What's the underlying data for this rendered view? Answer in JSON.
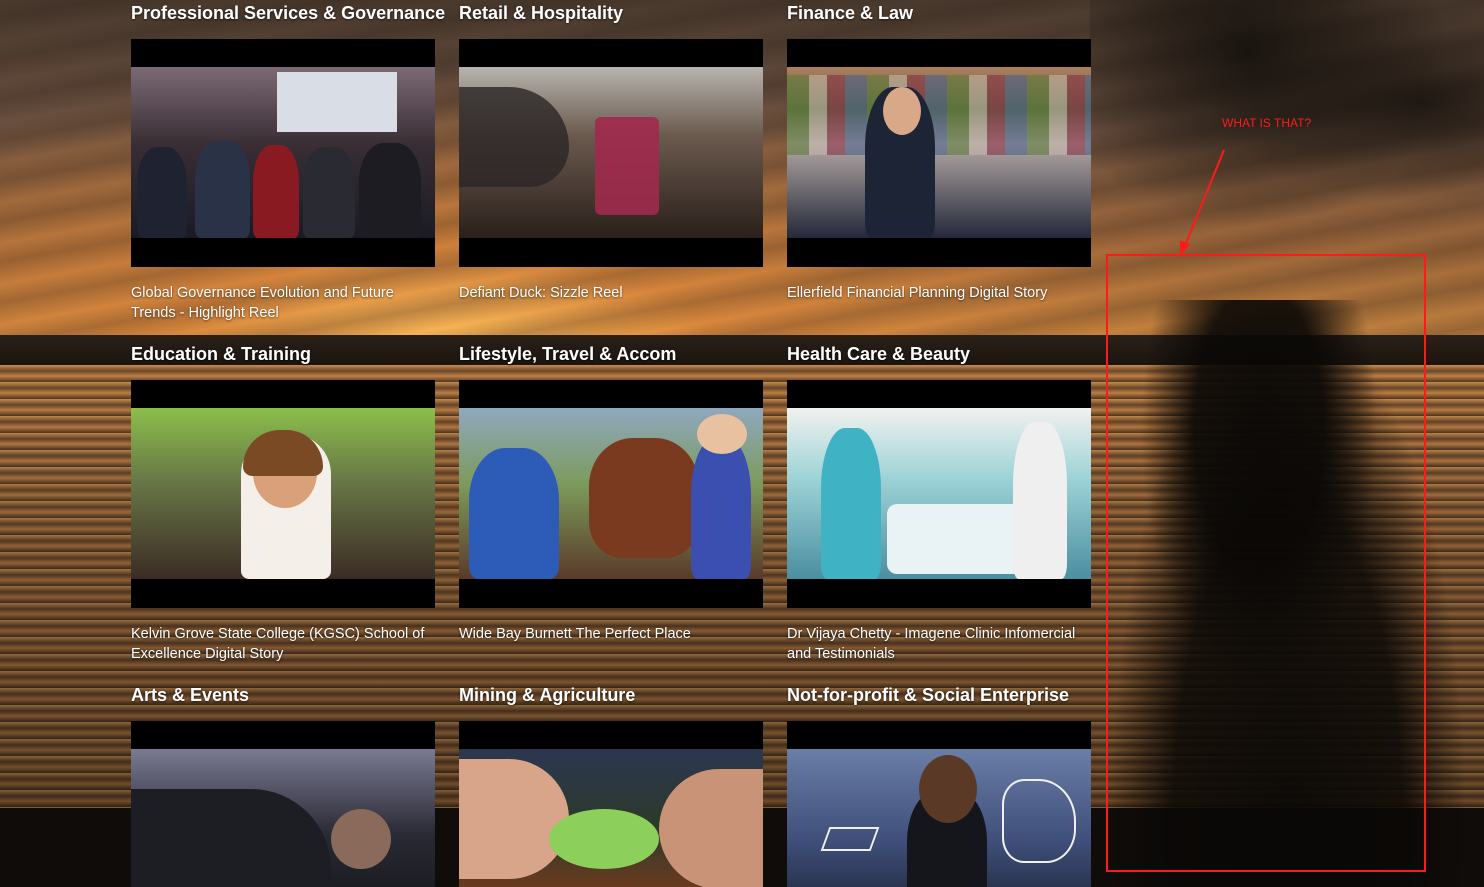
{
  "sections": [
    {
      "title": "Professional Services & Governance",
      "video": "Global Governance Evolution and Future Trends - Highlight Reel"
    },
    {
      "title": "Retail & Hospitality",
      "video": "Defiant Duck: Sizzle Reel"
    },
    {
      "title": "Finance & Law",
      "video": "Ellerfield Financial Planning Digital Story"
    },
    {
      "title": "Education & Training",
      "video": "Kelvin Grove State College (KGSC) School of Excellence Digital Story"
    },
    {
      "title": "Lifestyle, Travel & Accom",
      "video": "Wide Bay Burnett The Perfect Place"
    },
    {
      "title": "Health Care & Beauty",
      "video": "Dr Vijaya Chetty - Imagene Clinic Infomercial and Testimonials"
    },
    {
      "title": "Arts & Events",
      "video": ""
    },
    {
      "title": "Mining & Agriculture",
      "video": ""
    },
    {
      "title": "Not-for-profit & Social Enterprise",
      "video": ""
    }
  ],
  "annotation": {
    "label": "WHAT IS THAT?",
    "color": "#ff1a1a"
  }
}
